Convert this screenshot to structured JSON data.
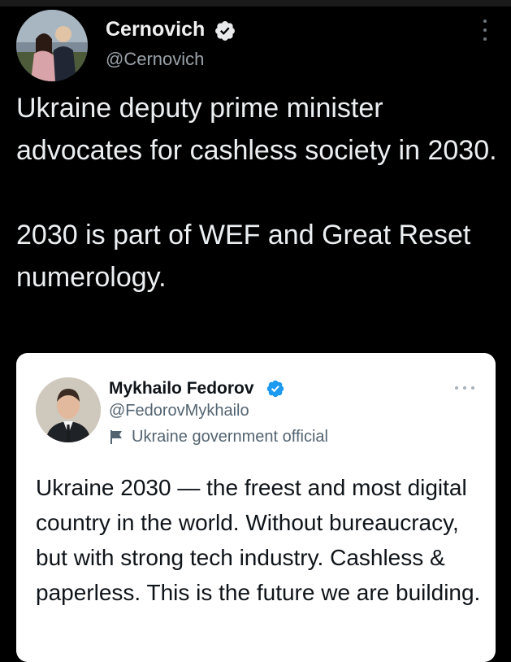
{
  "tweet": {
    "author_name": "Cernovich",
    "author_handle": "@Cernovich",
    "verified": true,
    "text_paragraphs": [
      "Ukraine deputy prime minister advocates for cashless society in 2030.",
      "2030 is part of WEF and Great Reset numerology."
    ],
    "more_icon": "more-vertical-icon"
  },
  "quoted_tweet": {
    "author_name": "Mykhailo Fedorov",
    "author_handle": "@FedorovMykhailo",
    "verified": true,
    "label_icon": "flag-icon",
    "label": "Ukraine government official",
    "text": "Ukraine 2030 — the freest and most digital country in the world. Without bureaucracy, but with strong tech industry. Cashless & paperless. This is the future we are building.",
    "more_icon": "more-horizontal-icon"
  },
  "colors": {
    "background": "#000000",
    "text_primary": "#e7e9ea",
    "text_secondary": "#9aa2a9",
    "verified_blue": "#1d9bf0",
    "quote_card_bg": "#ffffff",
    "quote_text_secondary": "#536471"
  }
}
